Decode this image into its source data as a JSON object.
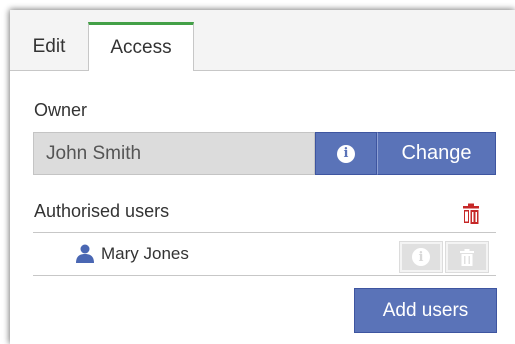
{
  "tabs": [
    {
      "label": "Edit",
      "active": false
    },
    {
      "label": "Access",
      "active": true
    }
  ],
  "owner": {
    "label": "Owner",
    "value": "John Smith",
    "info_icon": "info-icon",
    "change_label": "Change"
  },
  "authorised": {
    "label": "Authorised users",
    "delete_all_icon": "trash-multiple-icon",
    "users": [
      {
        "name": "Mary Jones",
        "icon": "user-icon"
      }
    ]
  },
  "add_users_label": "Add users",
  "colors": {
    "accent_blue": "#5a73b8",
    "active_tab_border": "#43a047",
    "delete_red": "#c62828",
    "user_icon_blue": "#4a67b3"
  }
}
